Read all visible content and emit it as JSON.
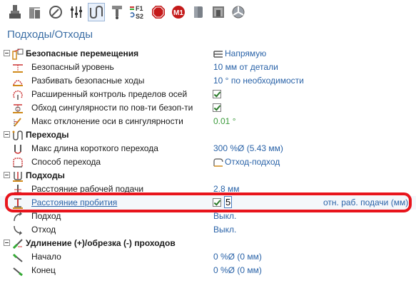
{
  "toolbar": {
    "icons": [
      "tool-holder-icon",
      "stock-icon",
      "rotation-icon",
      "cutting-params-icon",
      "links-icon",
      "sensing-icon",
      "feed-speed-icon",
      "stop-icon",
      "macro-icon",
      "cylinder-icon",
      "machine-tool-icon",
      "nc-settings-icon"
    ],
    "active_index": 4,
    "fs_label_top": "F1",
    "fs_label_bottom": "S2",
    "m1_label": "M1"
  },
  "title": "Подходы/Отходы",
  "rows": [
    {
      "label": "Безопасные перемещения",
      "value": "Напрямую",
      "group": true
    },
    {
      "label": "Безопасный уровень",
      "value": "10 мм от детали"
    },
    {
      "label": "Разбивать безопасные ходы",
      "value": "10 ° по необходимости"
    },
    {
      "label": "Расширенный контроль пределов осей",
      "checked": true
    },
    {
      "label": "Обход сингулярности по пов-ти безоп-ти",
      "checked": true
    },
    {
      "label": "Макс отклонение оси в сингулярности",
      "value": "0.01 °"
    },
    {
      "label": "Переходы",
      "group": true
    },
    {
      "label": "Макс длина короткого перехода",
      "value": "300 %Ø (5.43 мм)"
    },
    {
      "label": "Способ перехода",
      "value": "Отход-подход"
    },
    {
      "label": "Подходы",
      "group": true
    },
    {
      "label": "Расстояние рабочей подачи",
      "value": "2.8 мм"
    },
    {
      "label": "Расстояние пробития",
      "checked": true,
      "edit_value": "5",
      "suffix": "отн. раб. подачи (мм)"
    },
    {
      "label": "Подход",
      "value": "Выкл."
    },
    {
      "label": "Отход",
      "value": "Выкл."
    },
    {
      "label": "Удлинение (+)/обрезка (-) проходов",
      "group": true
    },
    {
      "label": "Начало",
      "value": "0 %Ø (0 мм)"
    },
    {
      "label": "Конец",
      "value": "0 %Ø (0 мм)"
    }
  ],
  "colors": {
    "accent": "#2a63a8",
    "highlight": "#e8141c",
    "value_green": "#3b9a3b",
    "title": "#3b6ea5"
  }
}
